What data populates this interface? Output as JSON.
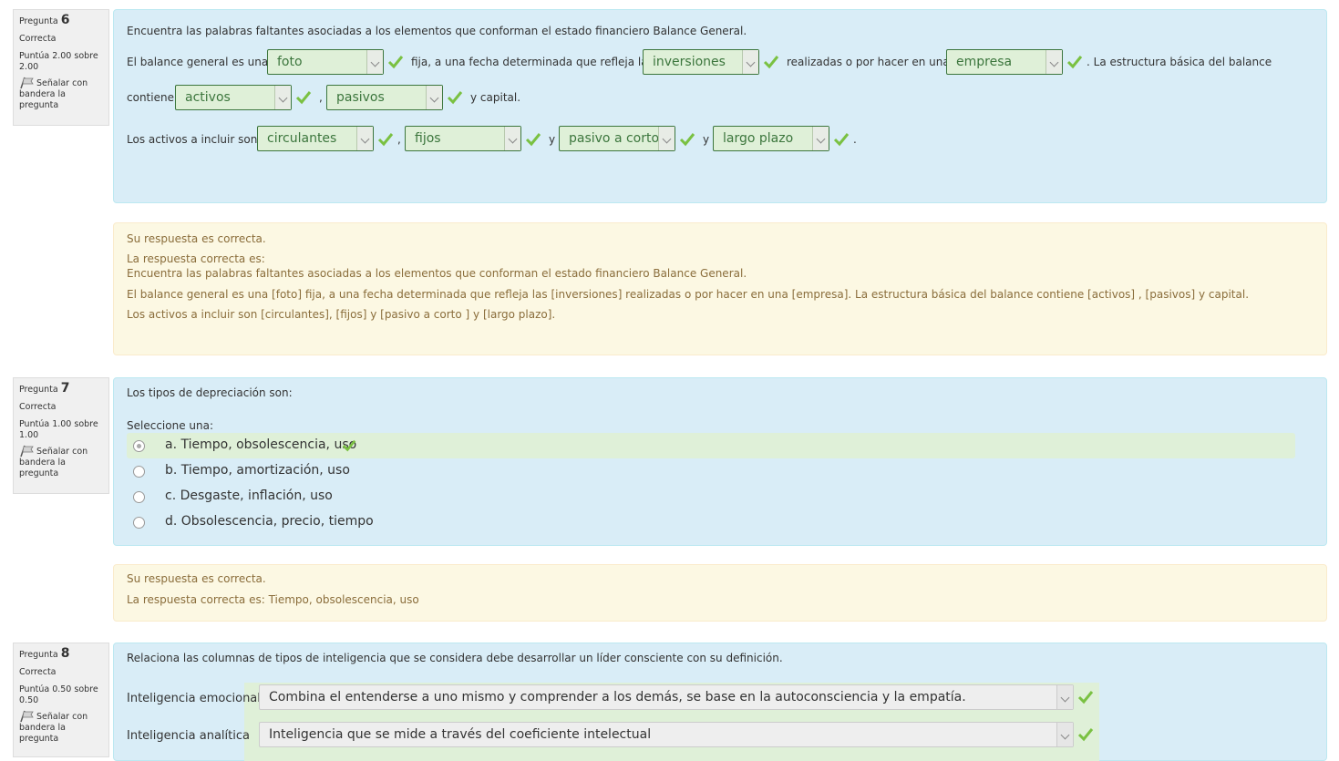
{
  "q6": {
    "info": {
      "question_label": "Pregunta",
      "number": "6",
      "state": "Correcta",
      "grade": "Puntúa 2.00 sobre 2.00",
      "flag": "Señalar con bandera la pregunta"
    },
    "prompt": "Encuentra las palabras faltantes asociadas a los elementos que conforman el estado financiero Balance General.",
    "line1": {
      "t1": "El balance general es una",
      "s1": "foto",
      "t2": "fija, a una fecha determinada que refleja las",
      "s2": "inversiones",
      "t3": "realizadas o por hacer en una",
      "s3": "empresa",
      "t4": ". La estructura básica del balance"
    },
    "line2": {
      "t1": "contiene",
      "s1": "activos",
      "t2": ",",
      "s2": "pasivos",
      "t3": "y capital."
    },
    "line3": {
      "t1": "Los activos a incluir son",
      "s1": "circulantes",
      "t2": ",",
      "s2": "fijos",
      "t3": "y",
      "s3": "pasivo a corto",
      "t4": "y",
      "s4": "largo plazo",
      "t5": "."
    },
    "feedback": {
      "status": "Su respuesta es correcta.",
      "right_answer_label": "La respuesta correcta es:",
      "r1": "Encuentra las palabras faltantes asociadas a los elementos que conforman el estado financiero Balance General.",
      "r2": "El balance general es una [foto] fija, a una fecha determinada que refleja las [inversiones] realizadas o por hacer en una [empresa]. La estructura básica del balance contiene [activos] , [pasivos] y capital.",
      "r3": "Los activos a incluir son [circulantes], [fijos] y [pasivo a corto ] y [largo plazo]."
    }
  },
  "q7": {
    "info": {
      "question_label": "Pregunta",
      "number": "7",
      "state": "Correcta",
      "grade": "Puntúa 1.00 sobre 1.00",
      "flag": "Señalar con bandera la pregunta"
    },
    "prompt": "Los tipos de depreciación son:",
    "select_one": "Seleccione una:",
    "options": [
      "a. Tiempo, obsolescencia, uso",
      "b. Tiempo, amortización, uso",
      "c. Desgaste, inflación, uso",
      "d. Obsolescencia, precio, tiempo"
    ],
    "feedback": {
      "status": "Su respuesta es correcta.",
      "right_answer": "La respuesta correcta es: Tiempo, obsolescencia, uso"
    }
  },
  "q8": {
    "info": {
      "question_label": "Pregunta",
      "number": "8",
      "state": "Correcta",
      "grade": "Puntúa 0.50 sobre 0.50",
      "flag": "Señalar con bandera la pregunta"
    },
    "prompt": "Relaciona las columnas de tipos de inteligencia que se considera debe desarrollar un líder consciente con su definición.",
    "rows": [
      {
        "label": "Inteligencia emocional",
        "value": "Combina el entenderse a uno mismo y comprender a los demás, se base en la autoconsciencia y la empatía."
      },
      {
        "label": "Inteligencia analítica",
        "value": "Inteligencia que se mide a través del coeficiente intelectual"
      }
    ]
  },
  "colors": {
    "question_bg": "#d9edf7",
    "feedback_bg": "#fcf8e3",
    "correct_bg": "#dff0d8",
    "correct_fg": "#3c763d",
    "check": "#7ac142"
  }
}
